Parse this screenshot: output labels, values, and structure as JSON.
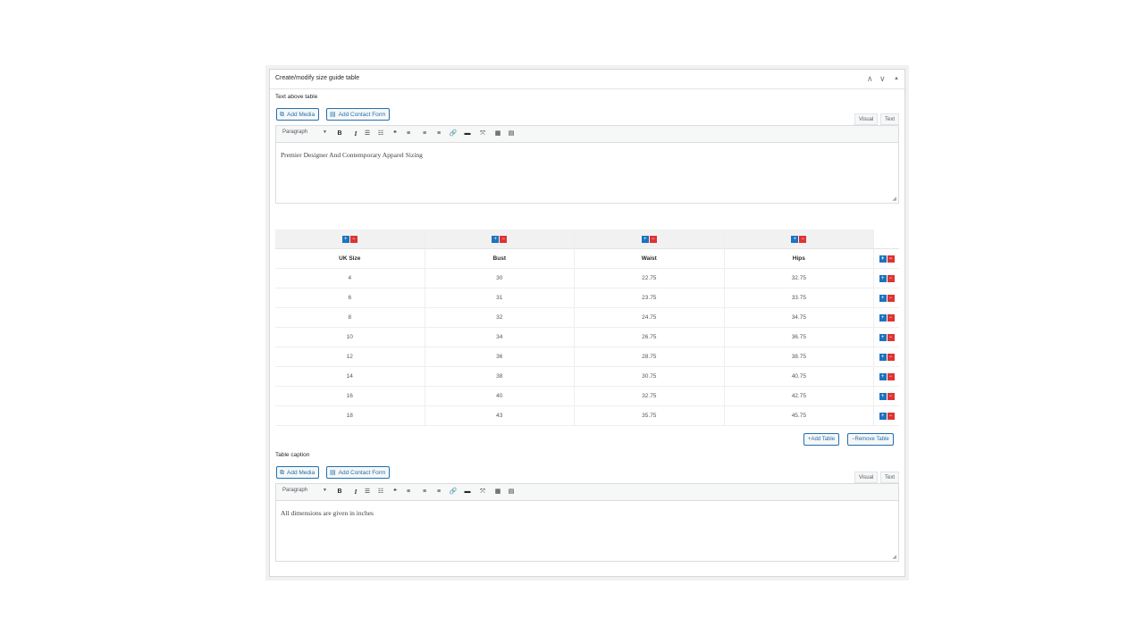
{
  "panel": {
    "title": "Create/modify size guide table",
    "controls": {
      "up": "∧",
      "down": "∨",
      "toggle": "▲"
    }
  },
  "top_editor": {
    "label": "Text above table",
    "add_media": "Add Media",
    "add_contact_form": "Add Contact Form",
    "tab_visual": "Visual",
    "tab_text": "Text",
    "format_select": "Paragraph",
    "content": "Premier Designer And Contemporary Apparel Sizing"
  },
  "table": {
    "plus_symbol": "+",
    "minus_symbol": "−",
    "headers": [
      "UK Size",
      "Bust",
      "Waist",
      "Hips"
    ],
    "rows": [
      [
        "4",
        "30",
        "22.75",
        "32.75"
      ],
      [
        "6",
        "31",
        "23.75",
        "33.75"
      ],
      [
        "8",
        "32",
        "24.75",
        "34.75"
      ],
      [
        "10",
        "34",
        "26.75",
        "36.75"
      ],
      [
        "12",
        "36",
        "28.75",
        "38.75"
      ],
      [
        "14",
        "38",
        "30.75",
        "40.75"
      ],
      [
        "16",
        "40",
        "32.75",
        "42.75"
      ],
      [
        "18",
        "43",
        "35.75",
        "45.75"
      ]
    ],
    "add_table": "Add Table",
    "remove_table": "Remove Table"
  },
  "bottom_editor": {
    "label": "Table caption",
    "add_media": "Add Media",
    "add_contact_form": "Add Contact Form",
    "tab_visual": "Visual",
    "tab_text": "Text",
    "format_select": "Paragraph",
    "content": "All dimensions are given in inches"
  },
  "toolbar_icons": [
    {
      "name": "bold-icon",
      "glyph": "B"
    },
    {
      "name": "italic-icon",
      "glyph": "I"
    },
    {
      "name": "bullet-list-icon",
      "glyph": "☰"
    },
    {
      "name": "numbered-list-icon",
      "glyph": "☷"
    },
    {
      "name": "blockquote-icon",
      "glyph": "❝"
    },
    {
      "name": "align-left-icon",
      "glyph": "≡"
    },
    {
      "name": "align-center-icon",
      "glyph": "≡"
    },
    {
      "name": "align-right-icon",
      "glyph": "≡"
    },
    {
      "name": "link-icon",
      "glyph": "🔗"
    },
    {
      "name": "read-more-icon",
      "glyph": "▬"
    },
    {
      "name": "fullscreen-icon",
      "glyph": "⤧"
    },
    {
      "name": "toolbar-toggle-icon",
      "glyph": "▦"
    },
    {
      "name": "keyboard-icon",
      "glyph": "▤"
    }
  ],
  "colors": {
    "accent": "#2271b1",
    "plus": "#1e73be",
    "minus": "#dd3333"
  }
}
